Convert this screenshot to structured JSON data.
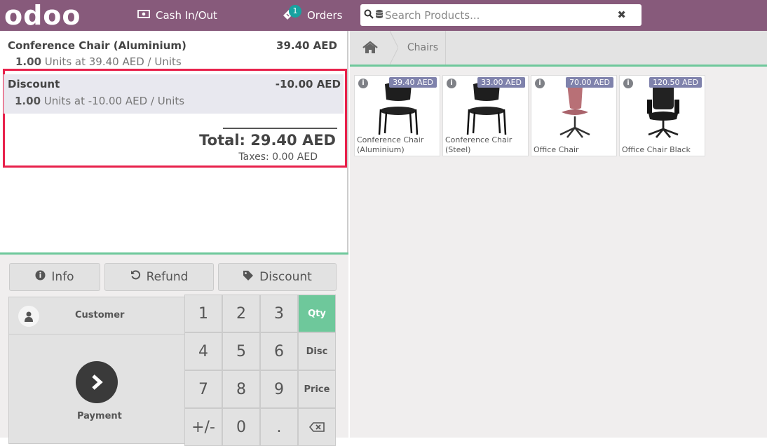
{
  "topbar": {
    "logo": "odoo",
    "cash_label": "Cash In/Out",
    "orders_label": "Orders",
    "orders_count": "1",
    "search_placeholder": "Search Products...",
    "search_value": ""
  },
  "order": {
    "lines": [
      {
        "name": "Conference Chair (Aluminium)",
        "price": "39.40 AED",
        "qty": "1.00",
        "detail": " Units at 39.40 AED / Units"
      },
      {
        "name": "Discount",
        "price": "-10.00 AED",
        "qty": "1.00",
        "detail": " Units at -10.00 AED / Units"
      }
    ],
    "total": "Total: 29.40 AED",
    "taxes": "Taxes: 0.00 AED"
  },
  "controls": {
    "info_label": "Info",
    "refund_label": "Refund",
    "discount_label": "Discount",
    "customer_label": "Customer",
    "payment_label": "Payment"
  },
  "numpad": {
    "keys": [
      "1",
      "2",
      "3",
      "4",
      "5",
      "6",
      "7",
      "8",
      "9",
      "+/-",
      "0",
      "."
    ],
    "modes": [
      "Qty",
      "Disc",
      "Price"
    ],
    "active_mode": "Qty"
  },
  "breadcrumb": {
    "category": "Chairs"
  },
  "products": [
    {
      "name": "Conference Chair (Aluminium)",
      "price": "39.40 AED",
      "icon": "black-stacking-chair"
    },
    {
      "name": "Conference Chair (Steel)",
      "price": "33.00 AED",
      "icon": "black-stacking-chair"
    },
    {
      "name": "Office Chair",
      "price": "70.00 AED",
      "icon": "pink-swivel-chair"
    },
    {
      "name": "Office Chair Black",
      "price": "120.50 AED",
      "icon": "black-executive-chair"
    }
  ],
  "colors": {
    "brand": "#875a7b",
    "accent": "#6ec89b",
    "highlight": "#e8214b",
    "price_tag": "#7f82ac"
  }
}
